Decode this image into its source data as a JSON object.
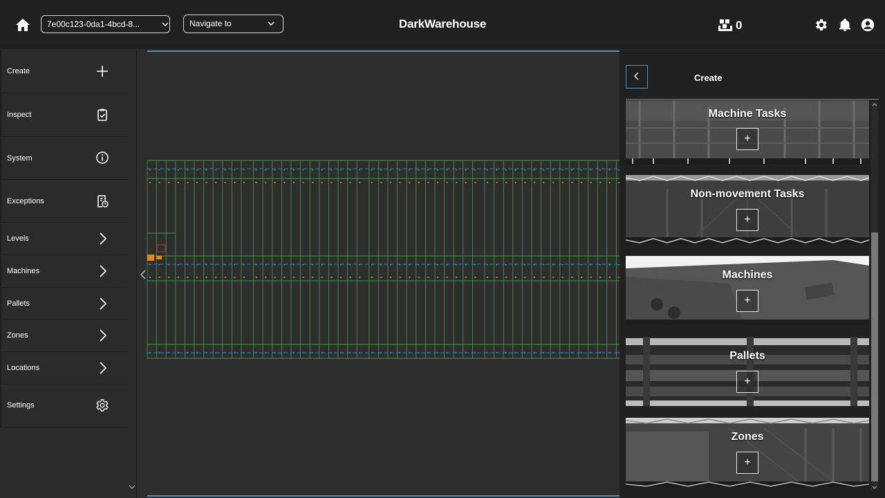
{
  "header": {
    "title": "DarkWarehouse",
    "warehouse_selector": "7e00c123-0da1-4bcd-8...",
    "navigate_selector": "Navigate to",
    "pallet_count": "0",
    "icons": [
      "home-icon",
      "pallet-icon",
      "gear-icon",
      "bell-icon",
      "account-icon"
    ]
  },
  "sidebar": {
    "items": [
      {
        "label": "Create",
        "icon": "plus-icon"
      },
      {
        "label": "Inspect",
        "icon": "clipboard-check-icon"
      },
      {
        "label": "System",
        "icon": "info-icon"
      },
      {
        "label": "Exceptions",
        "icon": "report-clock-icon"
      },
      {
        "label": "Levels",
        "icon": "chevron-right-icon"
      },
      {
        "label": "Machines",
        "icon": "chevron-right-icon"
      },
      {
        "label": "Pallets",
        "icon": "chevron-right-icon"
      },
      {
        "label": "Zones",
        "icon": "chevron-right-icon"
      },
      {
        "label": "Locations",
        "icon": "chevron-right-icon"
      },
      {
        "label": "Settings",
        "icon": "gear-icon"
      }
    ]
  },
  "panel": {
    "title": "Create",
    "cards": [
      {
        "label": "Machine Tasks",
        "action": "+"
      },
      {
        "label": "Non-movement Tasks",
        "action": "+"
      },
      {
        "label": "Machines",
        "action": "+"
      },
      {
        "label": "Pallets",
        "action": "+"
      },
      {
        "label": "Zones",
        "action": "+"
      }
    ]
  },
  "colors": {
    "background": "#2d2d2d",
    "topbar": "#202020",
    "accent": "#5a8fb8",
    "rack_green": "#4caf50",
    "rack_blue": "#3aa0d8",
    "rack_orange": "#e08a1e"
  }
}
